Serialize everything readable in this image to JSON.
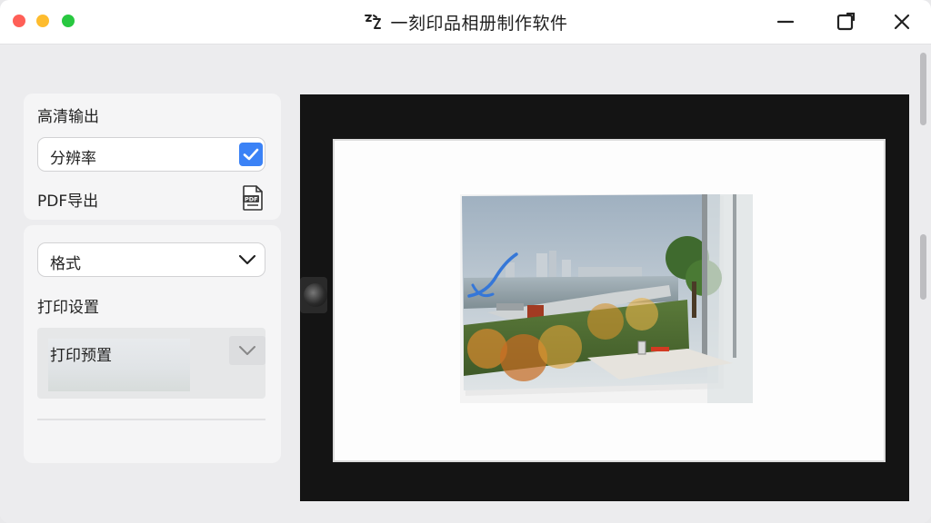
{
  "window": {
    "title": "一刻印品相册制作软件"
  },
  "left_panel": {
    "hd_output_label": "高清输出",
    "resolution_label": "分辨率",
    "resolution_checked": true,
    "pdf_export_label": "PDF导出",
    "format_select_value": "格式",
    "print_settings_label": "打印设置",
    "print_preview_label": "打印预置"
  },
  "icons": {
    "app": "app-logo-icon",
    "minimize": "minimize-icon",
    "maximize": "maximize-icon",
    "close": "close-icon",
    "checkbox": "check-icon",
    "pdf": "pdf-file-icon",
    "format_dropdown": "chevron-down-icon",
    "print_dropdown": "chevron-down-icon"
  },
  "colors": {
    "accent": "#3b82f6",
    "traffic_red": "#ff5f57",
    "traffic_yellow": "#febc2e",
    "traffic_green": "#28c840",
    "preview_bg": "#141414"
  }
}
